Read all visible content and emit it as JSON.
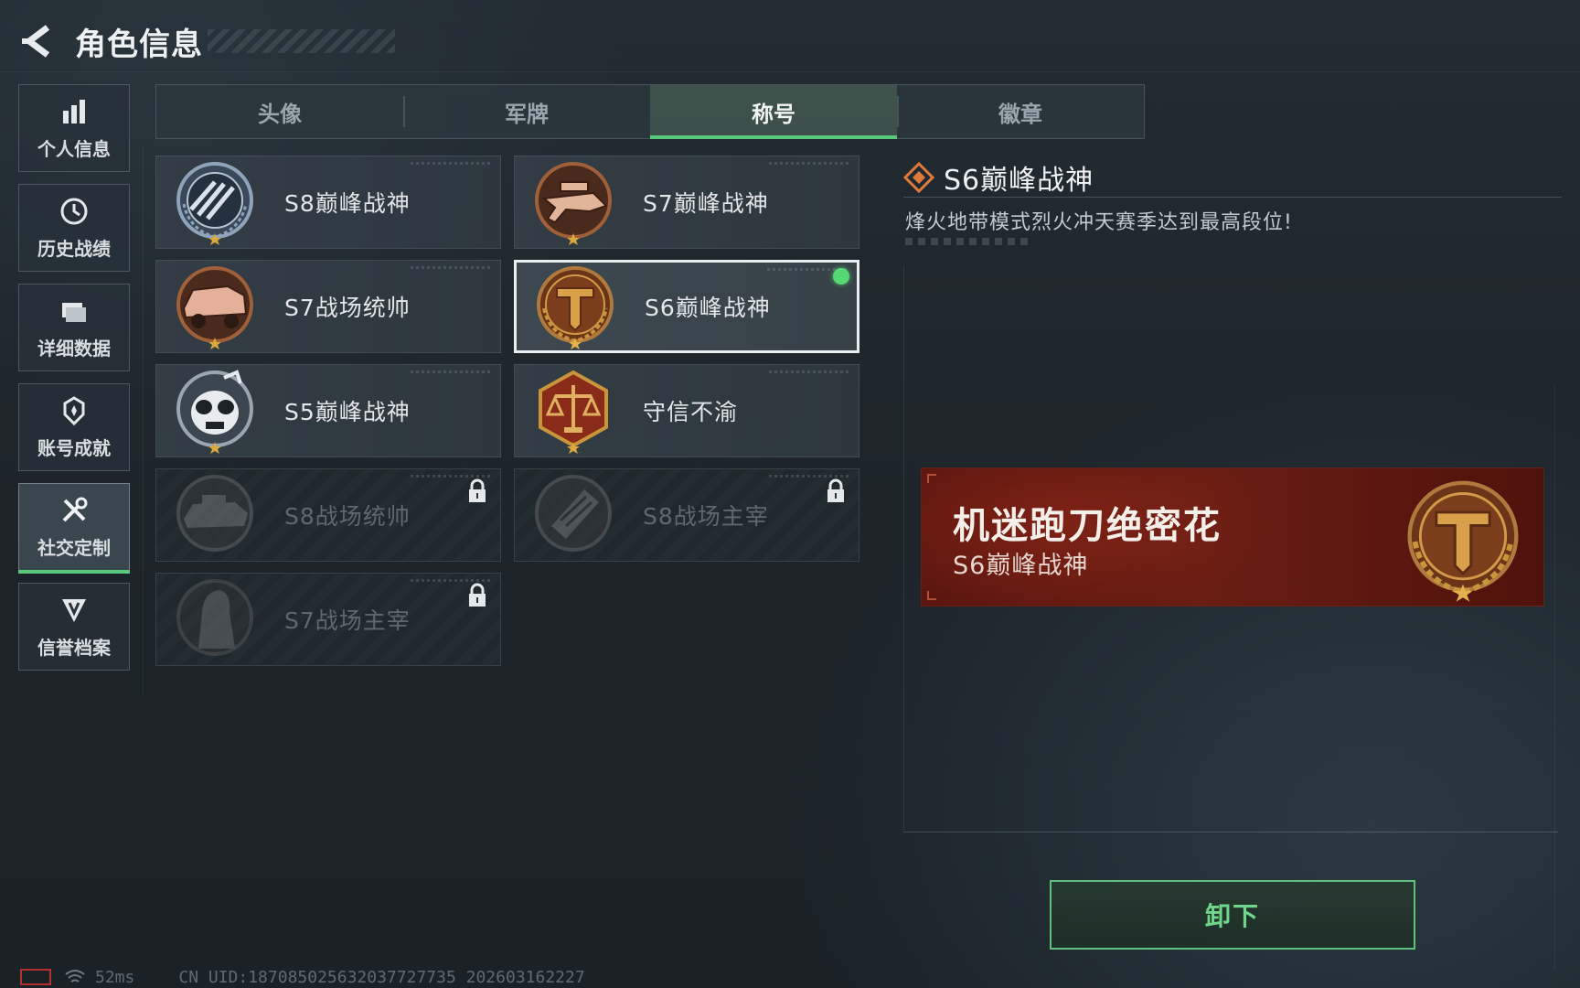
{
  "header": {
    "title": "角色信息"
  },
  "sidebar": {
    "items": [
      {
        "label": "个人信息",
        "icon": "bar-chart-icon",
        "active": false
      },
      {
        "label": "历史战绩",
        "icon": "history-clock-icon",
        "active": false
      },
      {
        "label": "详细数据",
        "icon": "folder-icon",
        "active": false
      },
      {
        "label": "账号成就",
        "icon": "medal-icon",
        "active": false
      },
      {
        "label": "社交定制",
        "icon": "wrench-screwdriver-icon",
        "active": true
      },
      {
        "label": "信誉档案",
        "icon": "shield-badge-icon",
        "active": false
      }
    ]
  },
  "tabs": [
    {
      "label": "头像",
      "active": false
    },
    {
      "label": "军牌",
      "active": false
    },
    {
      "label": "称号",
      "active": true
    },
    {
      "label": "徽章",
      "active": false
    }
  ],
  "titles": [
    {
      "name": "S8巅峰战神",
      "emblem": "s8-peak-emblem",
      "locked": false,
      "selected": false
    },
    {
      "name": "S7巅峰战神",
      "emblem": "s7-peak-emblem",
      "locked": false,
      "selected": false
    },
    {
      "name": "S7战场统帅",
      "emblem": "s7-commander-emblem",
      "locked": false,
      "selected": false
    },
    {
      "name": "S6巅峰战神",
      "emblem": "s6-peak-emblem",
      "locked": false,
      "selected": true,
      "equipped": true
    },
    {
      "name": "S5巅峰战神",
      "emblem": "s5-peak-emblem",
      "locked": false,
      "selected": false
    },
    {
      "name": "守信不渝",
      "emblem": "scales-emblem",
      "locked": false,
      "selected": false
    },
    {
      "name": "S8战场统帅",
      "emblem": "s8-commander-emblem",
      "locked": true,
      "selected": false
    },
    {
      "name": "S8战场主宰",
      "emblem": "s8-dominator-emblem",
      "locked": true,
      "selected": false
    },
    {
      "name": "S7战场主宰",
      "emblem": "s7-dominator-emblem",
      "locked": true,
      "selected": false
    }
  ],
  "detail": {
    "title": "S6巅峰战神",
    "description": "烽火地带模式烈火冲天赛季达到最高段位!"
  },
  "banner": {
    "player_name": "机迷跑刀绝密花",
    "title": "S6巅峰战神"
  },
  "actions": {
    "unequip_label": "卸下"
  },
  "status": {
    "ping": "52ms",
    "uid": "CN UID:18708502563203772773​5 202603162227"
  },
  "colors": {
    "accent_green": "#58c87a",
    "equipped_dot": "#56d874",
    "banner_red": "#5b160f",
    "emblem_gold": "#c9953a"
  }
}
